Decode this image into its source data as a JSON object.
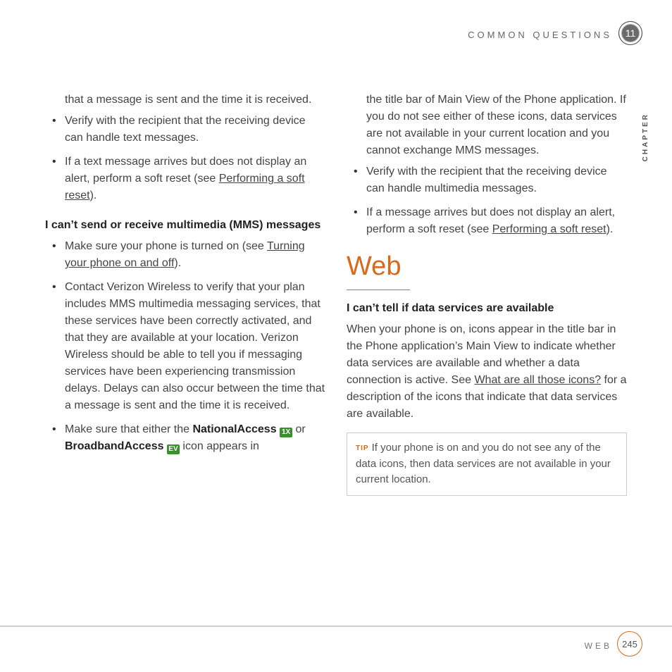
{
  "header": {
    "section_title": "COMMON QUESTIONS",
    "chapter_number": "11",
    "vertical_label": "CHAPTER"
  },
  "left": {
    "cont_para": "that a message is sent and the time it is received.",
    "bullets_a": [
      {
        "pre": "Verify with the recipient that the receiving device can handle text messages."
      },
      {
        "pre": "If a text message arrives but does not display an alert, perform a soft reset (see ",
        "link": "Performing a soft reset",
        "post": ")."
      }
    ],
    "subhead": "I can’t send or receive multimedia (MMS) messages",
    "bullets_b": {
      "i0": {
        "pre": "Make sure your phone is turned on (see ",
        "link": "Turning your phone on and off",
        "post": ")."
      },
      "i1": "Contact Verizon Wireless to verify that your plan includes MMS multimedia messaging services, that these services have been correctly activated, and that they are available at your location. Verizon Wireless should be able to tell you if messaging services have been experiencing transmission delays. Delays can also occur between the time that a message is sent and the time it is received.",
      "i2": {
        "pre": "Make sure that either the ",
        "strong1": "NationalAccess",
        "icon1_text": "1X",
        "mid": " or ",
        "strong2": "BroadbandAccess",
        "icon2_text": "EV",
        "post": " icon appears in "
      }
    }
  },
  "right": {
    "cont_para": "the title bar of Main View of the Phone application. If you do not see either of these icons, data services are not available in your current location and you cannot exchange MMS messages.",
    "bullets": [
      {
        "pre": "Verify with the recipient that the receiving device can handle multimedia messages."
      },
      {
        "pre": "If a message arrives but does not display an alert, perform a soft reset (see ",
        "link": "Performing a soft reset",
        "post": ")."
      }
    ],
    "section_heading": "Web",
    "sub1": "I can’t tell if data services are available",
    "para1": {
      "pre": "When your phone is on, icons appear in the title bar in the Phone application’s Main View to indicate whether data services are available and whether a data connection is active. See ",
      "link": "What are all those icons?",
      "post": " for a description of the icons that indicate that data services are available."
    },
    "tip": {
      "label": "TIP",
      "text": "If your phone is on and you do not see any of the data icons, then data services are not available in your current location."
    }
  },
  "footer": {
    "label": "WEB",
    "page": "245"
  }
}
